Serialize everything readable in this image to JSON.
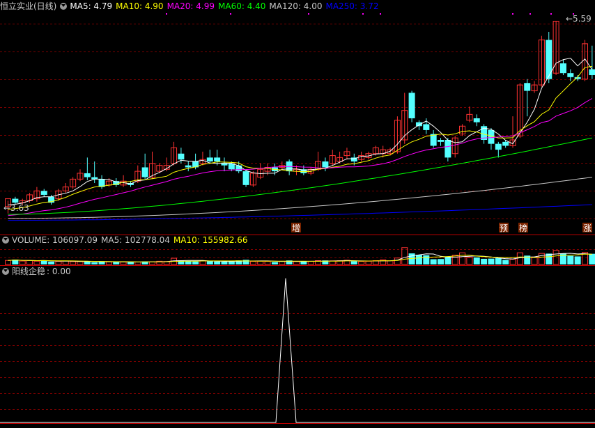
{
  "header": {
    "stock_name": "恒立实业(日线)",
    "ma5": "MA5: 4.79",
    "ma10": "MA10: 4.90",
    "ma20": "MA20: 4.99",
    "ma60": "MA60: 4.40",
    "ma120": "MA120: 4.00",
    "ma250": "MA250: 3.72"
  },
  "volume_header": {
    "volume": "VOLUME: 106097.09",
    "ma5": "MA5: 102778.04",
    "ma10": "MA10: 155982.66"
  },
  "indicator_header": {
    "label": "阳线企稳",
    "value": ": 0.00"
  },
  "price_annotations": {
    "high_label": "5.59",
    "low_label": "3.63"
  },
  "markers": [
    "增",
    "预",
    "榜",
    "涨"
  ],
  "colors": {
    "up": "#ff3232",
    "down": "#54ffff",
    "ma5": "#ffffff",
    "ma10": "#ffff00",
    "ma20": "#ff00ff",
    "ma60": "#00ff00",
    "ma120": "#c8c8c8",
    "ma250": "#0000ff",
    "grid": "#7a0000"
  },
  "chart_data": [
    {
      "type": "candlestick",
      "title": "恒立实业(日线)",
      "ylim": [
        3.55,
        5.65
      ],
      "annotations": [
        "5.59",
        "3.63"
      ],
      "candles": [
        [
          3.7,
          3.78,
          3.63,
          3.76
        ],
        [
          3.78,
          3.74,
          3.72,
          3.8
        ],
        [
          3.74,
          3.76,
          3.72,
          3.78
        ],
        [
          3.76,
          3.82,
          3.74,
          3.84
        ],
        [
          3.78,
          3.86,
          3.75,
          3.9
        ],
        [
          3.86,
          3.82,
          3.8,
          3.88
        ],
        [
          3.8,
          3.74,
          3.72,
          3.82
        ],
        [
          3.78,
          3.86,
          3.76,
          3.88
        ],
        [
          3.86,
          3.9,
          3.84,
          3.94
        ],
        [
          3.9,
          3.98,
          3.88,
          4.0
        ],
        [
          3.98,
          4.04,
          3.96,
          4.08
        ],
        [
          4.04,
          4.0,
          3.97,
          4.2
        ],
        [
          4.0,
          3.98,
          3.94,
          4.16
        ],
        [
          3.98,
          3.9,
          3.88,
          4.02
        ],
        [
          3.92,
          3.96,
          3.9,
          3.99
        ],
        [
          3.96,
          3.92,
          3.9,
          3.99
        ],
        [
          3.92,
          3.96,
          3.9,
          4.02
        ],
        [
          3.94,
          3.92,
          3.9,
          3.96
        ],
        [
          3.96,
          4.06,
          3.94,
          4.12
        ],
        [
          4.1,
          4.0,
          3.98,
          4.24
        ],
        [
          4.0,
          4.14,
          3.98,
          4.26
        ],
        [
          4.06,
          4.12,
          4.04,
          4.14
        ],
        [
          4.08,
          4.12,
          4.06,
          4.2
        ],
        [
          4.14,
          4.3,
          4.12,
          4.36
        ],
        [
          4.24,
          4.18,
          4.14,
          4.3
        ],
        [
          4.12,
          4.1,
          4.06,
          4.16
        ],
        [
          4.16,
          4.1,
          4.08,
          4.24
        ],
        [
          4.14,
          4.18,
          4.12,
          4.26
        ],
        [
          4.2,
          4.16,
          4.14,
          4.28
        ],
        [
          4.2,
          4.16,
          4.12,
          4.28
        ],
        [
          4.14,
          4.12,
          4.06,
          4.2
        ],
        [
          4.14,
          4.08,
          4.06,
          4.16
        ],
        [
          4.12,
          4.06,
          4.04,
          4.16
        ],
        [
          4.06,
          3.92,
          3.9,
          4.08
        ],
        [
          3.92,
          4.04,
          3.9,
          4.06
        ],
        [
          4.0,
          4.08,
          3.98,
          4.14
        ],
        [
          4.06,
          4.1,
          4.02,
          4.14
        ],
        [
          4.1,
          4.06,
          4.02,
          4.14
        ],
        [
          4.1,
          4.12,
          4.08,
          4.16
        ],
        [
          4.16,
          4.06,
          4.02,
          4.18
        ],
        [
          4.06,
          4.08,
          4.02,
          4.12
        ],
        [
          4.08,
          4.04,
          4.02,
          4.12
        ],
        [
          4.04,
          4.08,
          4.02,
          4.1
        ],
        [
          4.08,
          4.16,
          4.06,
          4.26
        ],
        [
          4.16,
          4.1,
          4.06,
          4.2
        ],
        [
          4.14,
          4.22,
          4.12,
          4.28
        ],
        [
          4.16,
          4.2,
          4.14,
          4.26
        ],
        [
          4.22,
          4.26,
          4.18,
          4.3
        ],
        [
          4.2,
          4.16,
          4.12,
          4.24
        ],
        [
          4.18,
          4.22,
          4.16,
          4.26
        ],
        [
          4.2,
          4.24,
          4.18,
          4.26
        ],
        [
          4.24,
          4.3,
          4.22,
          4.32
        ],
        [
          4.24,
          4.28,
          4.2,
          4.32
        ],
        [
          4.24,
          4.28,
          4.22,
          4.3
        ],
        [
          4.26,
          4.58,
          4.24,
          4.62
        ],
        [
          4.38,
          4.68,
          4.34,
          4.86
        ],
        [
          4.86,
          4.6,
          4.56,
          4.88
        ],
        [
          4.56,
          4.52,
          4.48,
          4.58
        ],
        [
          4.54,
          4.48,
          4.44,
          4.6
        ],
        [
          4.44,
          4.32,
          4.3,
          4.48
        ],
        [
          4.38,
          4.36,
          4.32,
          4.4
        ],
        [
          4.38,
          4.2,
          4.16,
          4.4
        ],
        [
          4.24,
          4.4,
          4.2,
          4.42
        ],
        [
          4.44,
          4.52,
          4.42,
          4.54
        ],
        [
          4.58,
          4.64,
          4.56,
          4.72
        ],
        [
          4.6,
          4.56,
          4.52,
          4.64
        ],
        [
          4.52,
          4.38,
          4.34,
          4.54
        ],
        [
          4.48,
          4.34,
          4.28,
          4.5
        ],
        [
          4.34,
          4.28,
          4.2,
          4.36
        ],
        [
          4.36,
          4.32,
          4.3,
          4.38
        ],
        [
          4.32,
          4.38,
          4.3,
          4.62
        ],
        [
          4.42,
          4.94,
          4.4,
          4.96
        ],
        [
          4.96,
          4.88,
          4.62,
          5.0
        ],
        [
          4.88,
          4.94,
          4.86,
          4.98
        ],
        [
          4.94,
          5.4,
          4.92,
          5.44
        ],
        [
          5.4,
          5.0,
          4.96,
          5.48
        ],
        [
          5.06,
          5.59,
          5.04,
          5.59
        ],
        [
          5.16,
          5.06,
          5.04,
          5.2
        ],
        [
          5.06,
          5.02,
          4.98,
          5.1
        ],
        [
          5.02,
          5.0,
          4.98,
          5.04
        ],
        [
          5.0,
          5.36,
          4.98,
          5.4
        ],
        [
          5.1,
          5.04,
          5.0,
          5.34
        ]
      ],
      "ma_last": {
        "MA5": 4.79,
        "MA10": 4.9,
        "MA20": 4.99,
        "MA60": 4.4,
        "MA120": 4.0,
        "MA250": 3.72
      }
    },
    {
      "type": "bar",
      "title": "VOLUME",
      "ylim": [
        0,
        180000
      ],
      "values": [
        40000,
        48000,
        34000,
        38000,
        32000,
        42000,
        28000,
        30000,
        34000,
        28000,
        28000,
        32000,
        22000,
        28000,
        26000,
        24000,
        24000,
        24000,
        24000,
        30000,
        26000,
        32000,
        30000,
        62000,
        40000,
        34000,
        30000,
        36000,
        32000,
        30000,
        28000,
        30000,
        40000,
        46000,
        30000,
        32000,
        30000,
        24000,
        32000,
        40000,
        28000,
        28000,
        30000,
        38000,
        40000,
        36000,
        38000,
        42000,
        32000,
        30000,
        32000,
        38000,
        46000,
        36000,
        64000,
        168000,
        110000,
        96000,
        92000,
        52000,
        54000,
        74000,
        92000,
        116000,
        72000,
        70000,
        56000,
        58000,
        62000,
        46000,
        52000,
        116000,
        88000,
        74000,
        110000,
        108000,
        140000,
        110000,
        86000,
        80000,
        120000,
        106097.09
      ],
      "ma_last": {
        "MA5": 102778.04,
        "MA10": 155982.66
      }
    },
    {
      "type": "line",
      "title": "阳线企稳",
      "values": [
        0,
        0,
        0,
        0,
        0,
        0,
        0,
        0,
        0,
        0,
        0,
        0,
        0,
        0,
        0,
        0,
        0,
        0,
        0,
        0,
        0,
        0,
        0,
        0,
        0,
        0,
        0,
        0,
        0,
        0,
        0,
        0,
        0,
        0,
        0,
        0,
        0,
        0,
        0,
        0,
        0,
        0,
        0,
        0,
        0,
        0,
        0,
        0,
        0,
        0,
        0,
        0,
        0,
        0,
        0,
        0,
        0,
        0,
        0,
        0,
        0,
        0,
        0,
        0,
        0,
        0,
        0,
        0,
        0,
        0,
        0,
        0,
        0,
        0,
        0,
        0,
        0,
        0,
        0,
        0,
        0,
        0
      ],
      "spike_index": 33,
      "spike_value": 1
    }
  ]
}
